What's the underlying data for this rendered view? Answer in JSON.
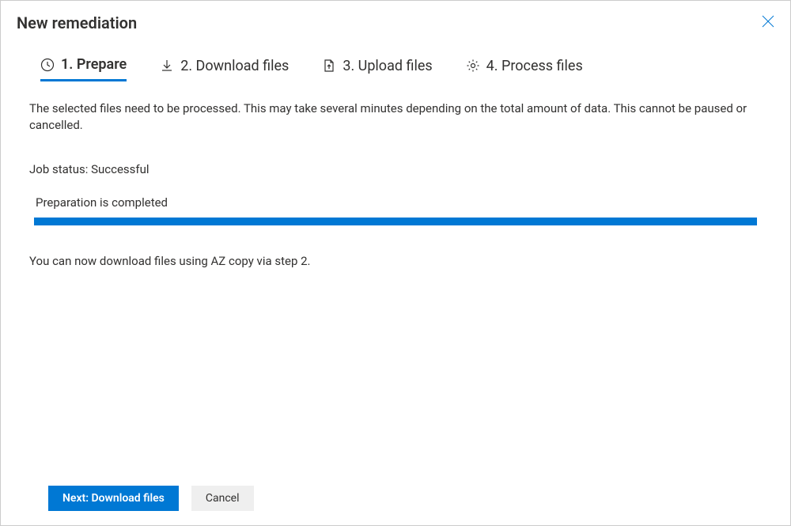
{
  "header": {
    "title": "New remediation"
  },
  "tabs": [
    {
      "label": "1. Prepare",
      "icon": "clock-icon",
      "active": true
    },
    {
      "label": "2. Download files",
      "icon": "download-icon",
      "active": false
    },
    {
      "label": "3. Upload files",
      "icon": "upload-doc-icon",
      "active": false
    },
    {
      "label": "4. Process files",
      "icon": "gear-icon",
      "active": false
    }
  ],
  "main": {
    "description": "The selected files need to be processed. This may take several minutes depending on the total amount of data. This cannot be paused or cancelled.",
    "status_label": "Job status:",
    "status_value": "Successful",
    "progress_label": "Preparation is completed",
    "progress_percent": 100,
    "hint": "You can now download files using AZ copy via step 2."
  },
  "footer": {
    "primary": "Next: Download files",
    "secondary": "Cancel"
  },
  "colors": {
    "accent": "#0078d4"
  }
}
